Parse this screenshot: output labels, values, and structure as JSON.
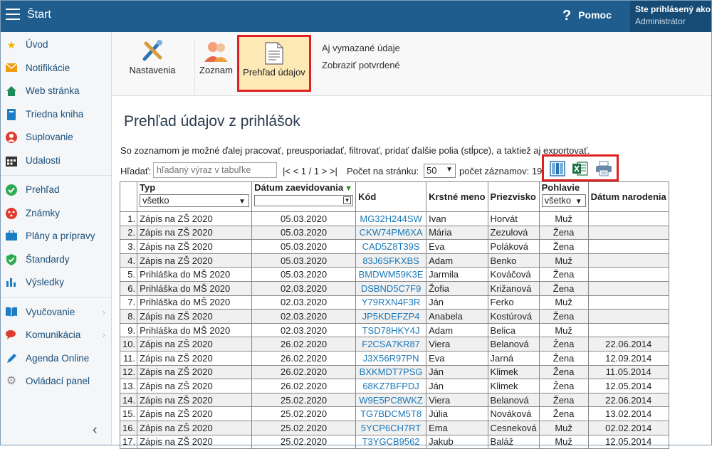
{
  "topbar": {
    "title": "Štart",
    "help_label": "Pomoc",
    "user_line1": "Ste prihlásený ako",
    "user_line2": "Administrátor"
  },
  "sidebar": {
    "items": [
      {
        "label": "Úvod",
        "icon": "star-icon",
        "color": "#f0b400"
      },
      {
        "label": "Notifikácie",
        "icon": "envelope-icon",
        "color": "#f39c12"
      },
      {
        "label": "Web stránka",
        "icon": "home-icon",
        "color": "#1e8c5a"
      },
      {
        "label": "Triedna kniha",
        "icon": "book-icon",
        "color": "#1c7cc4"
      },
      {
        "label": "Suplovanie",
        "icon": "person-icon",
        "color": "#e03a2e"
      },
      {
        "label": "Udalosti",
        "icon": "calendar-icon",
        "color": "#333333"
      },
      {
        "label": "Prehľad",
        "icon": "check-circle-icon",
        "color": "#2eaa52"
      },
      {
        "label": "Známky",
        "icon": "dots-circle-icon",
        "color": "#e03a2e"
      },
      {
        "label": "Plány a prípravy",
        "icon": "briefcase-icon",
        "color": "#1c7cc4"
      },
      {
        "label": "Štandardy",
        "icon": "shield-check-icon",
        "color": "#2eaa52"
      },
      {
        "label": "Výsledky",
        "icon": "bar-chart-icon",
        "color": "#1c7cc4"
      },
      {
        "label": "Vyučovanie",
        "icon": "open-book-icon",
        "color": "#1c7cc4"
      },
      {
        "label": "Komunikácia",
        "icon": "chat-icon",
        "color": "#e03a2e"
      },
      {
        "label": "Agenda Online",
        "icon": "pen-icon",
        "color": "#1c7cc4"
      },
      {
        "label": "Ovládací panel",
        "icon": "gear-icon",
        "color": "#888888"
      }
    ]
  },
  "toolbar": {
    "settings_label": "Nastavenia",
    "list_label": "Zoznam",
    "overview_label": "Prehľad údajov",
    "link_deleted": "Aj vymazané údaje",
    "link_confirmed": "Zobraziť potvrdené"
  },
  "main": {
    "title": "Prehľad údajov z prihlášok",
    "description": "So zoznamom je možné ďalej pracovať, preusporiadať, filtrovať, pridať ďalšie polia (stĺpce), a taktiež aj exportovať.",
    "search_label": "Hľadať:",
    "search_placeholder": "hľadaný výraz v tabuľke",
    "pager": "|< < 1 / 1 > >|",
    "per_page_label": "Počet na stránku:",
    "per_page_value": "50",
    "count_label": "počet záznamov: 19"
  },
  "table": {
    "headers": {
      "type": "Typ",
      "date": "Dátum zaevidovania",
      "code": "Kód",
      "first": "Krstné meno",
      "last": "Priezvisko",
      "sex": "Pohlavie",
      "birth": "Dátum narodenia"
    },
    "type_filter": "všetko",
    "sex_filter": "všetko",
    "rows": [
      {
        "n": "1.",
        "type": "Zápis na ZŠ 2020",
        "date": "05.03.2020",
        "code": "MG32H244SW",
        "first": "Ivan",
        "last": "Horvát",
        "sex": "Muž",
        "birth": ""
      },
      {
        "n": "2.",
        "type": "Zápis na ZŠ 2020",
        "date": "05.03.2020",
        "code": "CKW74PM6XA",
        "first": "Mária",
        "last": "Zezulová",
        "sex": "Žena",
        "birth": ""
      },
      {
        "n": "3.",
        "type": "Zápis na ZŠ 2020",
        "date": "05.03.2020",
        "code": "CAD5Z8T39S",
        "first": "Eva",
        "last": "Poláková",
        "sex": "Žena",
        "birth": ""
      },
      {
        "n": "4.",
        "type": "Zápis na ZŠ 2020",
        "date": "05.03.2020",
        "code": "83J6SFKXBS",
        "first": "Adam",
        "last": "Benko",
        "sex": "Muž",
        "birth": ""
      },
      {
        "n": "5.",
        "type": "Prihláška do MŠ 2020",
        "date": "05.03.2020",
        "code": "BMDWM59K3E",
        "first": "Jarmila",
        "last": "Kováčová",
        "sex": "Žena",
        "birth": ""
      },
      {
        "n": "6.",
        "type": "Prihláška do MŠ 2020",
        "date": "02.03.2020",
        "code": "DSBND5C7F9",
        "first": "Žofia",
        "last": "Križanová",
        "sex": "Žena",
        "birth": ""
      },
      {
        "n": "7.",
        "type": "Prihláška do MŠ 2020",
        "date": "02.03.2020",
        "code": "Y79RXN4F3R",
        "first": "Ján",
        "last": "Ferko",
        "sex": "Muž",
        "birth": ""
      },
      {
        "n": "8.",
        "type": "Zápis na ZŠ 2020",
        "date": "02.03.2020",
        "code": "JP5KDEFZP4",
        "first": "Anabela",
        "last": "Kostúrová",
        "sex": "Žena",
        "birth": ""
      },
      {
        "n": "9.",
        "type": "Prihláška do MŠ 2020",
        "date": "02.03.2020",
        "code": "TSD78HKY4J",
        "first": "Adam",
        "last": "Belica",
        "sex": "Muž",
        "birth": ""
      },
      {
        "n": "10.",
        "type": "Zápis na ZŠ 2020",
        "date": "26.02.2020",
        "code": "F2CSA7KR87",
        "first": "Viera",
        "last": "Belanová",
        "sex": "Žena",
        "birth": "22.06.2014"
      },
      {
        "n": "11.",
        "type": "Zápis na ZŠ 2020",
        "date": "26.02.2020",
        "code": "J3X56R97PN",
        "first": "Eva",
        "last": "Jarná",
        "sex": "Žena",
        "birth": "12.09.2014"
      },
      {
        "n": "12.",
        "type": "Zápis na ZŠ 2020",
        "date": "26.02.2020",
        "code": "BXKMDT7PSG",
        "first": "Ján",
        "last": "Klimek",
        "sex": "Žena",
        "birth": "11.05.2014"
      },
      {
        "n": "13.",
        "type": "Zápis na ZŠ 2020",
        "date": "26.02.2020",
        "code": "68KZ7BFPDJ",
        "first": "Ján",
        "last": "Klimek",
        "sex": "Žena",
        "birth": "12.05.2014"
      },
      {
        "n": "14.",
        "type": "Zápis na ZŠ 2020",
        "date": "25.02.2020",
        "code": "W9E5PC8WKZ",
        "first": "Viera",
        "last": "Belanová",
        "sex": "Žena",
        "birth": "22.06.2014"
      },
      {
        "n": "15.",
        "type": "Zápis na ZŠ 2020",
        "date": "25.02.2020",
        "code": "TG7BDCM5T8",
        "first": "Júlia",
        "last": "Nováková",
        "sex": "Žena",
        "birth": "13.02.2014"
      },
      {
        "n": "16.",
        "type": "Zápis na ZŠ 2020",
        "date": "25.02.2020",
        "code": "5YCP6CH7RT",
        "first": "Ema",
        "last": "Cesneková",
        "sex": "Muž",
        "birth": "02.02.2014"
      },
      {
        "n": "17.",
        "type": "Zápis na ZŠ 2020",
        "date": "25.02.2020",
        "code": "T3YGCB9562",
        "first": "Jakub",
        "last": "Baláž",
        "sex": "Muž",
        "birth": "12.05.2014"
      }
    ]
  }
}
